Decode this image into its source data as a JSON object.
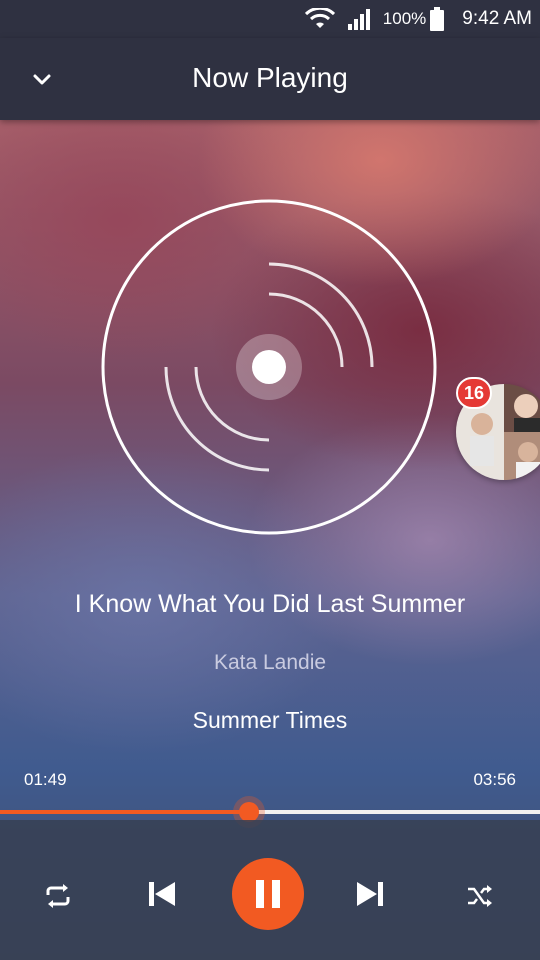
{
  "status_bar": {
    "battery": "100%",
    "time": "9:42 AM",
    "icons": [
      "wifi-icon",
      "signal-icon",
      "battery-icon"
    ]
  },
  "header": {
    "title": "Now Playing",
    "collapse_icon": "chevron-down-icon"
  },
  "now_playing": {
    "title": "I Know What You Did Last Summer",
    "artist": "Kata Landie",
    "album": "Summer Times",
    "art_icon": "disc-icon"
  },
  "chat_head": {
    "badge_count": "16",
    "icon": "chat-head-avatar"
  },
  "playback": {
    "elapsed": "01:49",
    "duration": "03:56",
    "progress_fraction": 0.462
  },
  "controls": {
    "repeat_icon": "repeat-icon",
    "prev_icon": "skip-previous-icon",
    "play_pause_icon": "pause-icon",
    "next_icon": "skip-next-icon",
    "shuffle_icon": "shuffle-icon"
  },
  "colors": {
    "accent": "#f25a22",
    "bar_bg": "#2f3141",
    "badge": "#e53935"
  }
}
